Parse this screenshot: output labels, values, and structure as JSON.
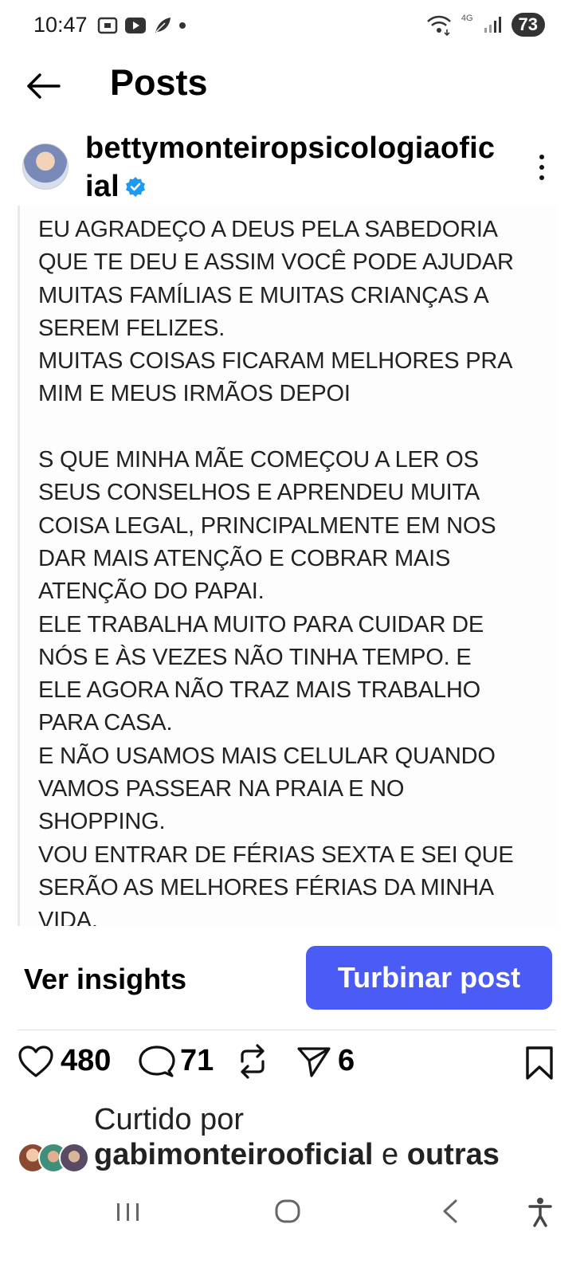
{
  "status_bar": {
    "time": "10:47",
    "network": "4G",
    "battery": "73"
  },
  "header": {
    "title": "Posts"
  },
  "post": {
    "account_name": "bettymonteiropsicologiaoficial",
    "text": "EU AGRADEÇO A DEUS PELA SABEDORIA\nQUE TE DEU E ASSIM VOCÊ PODE AJUDAR\nMUITAS FAMÍLIAS E MUITAS CRIANÇAS A\nSEREM FELIZES.\nMUITAS COISAS FICARAM MELHORES PRA\nMIM E MEUS IRMÃOS DEPOI\n\nS QUE MINHA MÃE COMEÇOU A LER OS\nSEUS CONSELHOS E APRENDEU MUITA\nCOISA LEGAL, PRINCIPALMENTE EM NOS\nDAR MAIS ATENÇÃO E COBRAR MAIS\nATENÇÃO DO PAPAI.\nELE TRABALHA MUITO PARA CUIDAR DE\nNÓS E ÀS VEZES NÃO TINHA TEMPO. E\nELE AGORA NÃO TRAZ MAIS TRABALHO\nPARA CASA.\nE NÃO USAMOS MAIS CELULAR QUANDO\nVAMOS PASSEAR NA PRAIA E NO\nSHOPPING.\nVOU ENTRAR DE FÉRIAS SEXTA E SEI QUE\nSERÃO AS MELHORES FÉRIAS DA MINHA\nVIDA."
  },
  "actions": {
    "insights_label": "Ver insights",
    "boost_label": "Turbinar post"
  },
  "stats": {
    "likes": "480",
    "comments": "71",
    "shares": "6"
  },
  "liked_by": {
    "prefix": "Curtido por",
    "user": "gabimonteirooficial",
    "connector": " e ",
    "others": "outras"
  },
  "colors": {
    "boost_button": "#4a5cf5",
    "verified_badge": "#1d9bf0"
  },
  "icons": [
    "back-arrow-icon",
    "verified-icon",
    "more-icon",
    "heart-icon",
    "comment-icon",
    "repost-icon",
    "send-icon",
    "bookmark-icon"
  ]
}
